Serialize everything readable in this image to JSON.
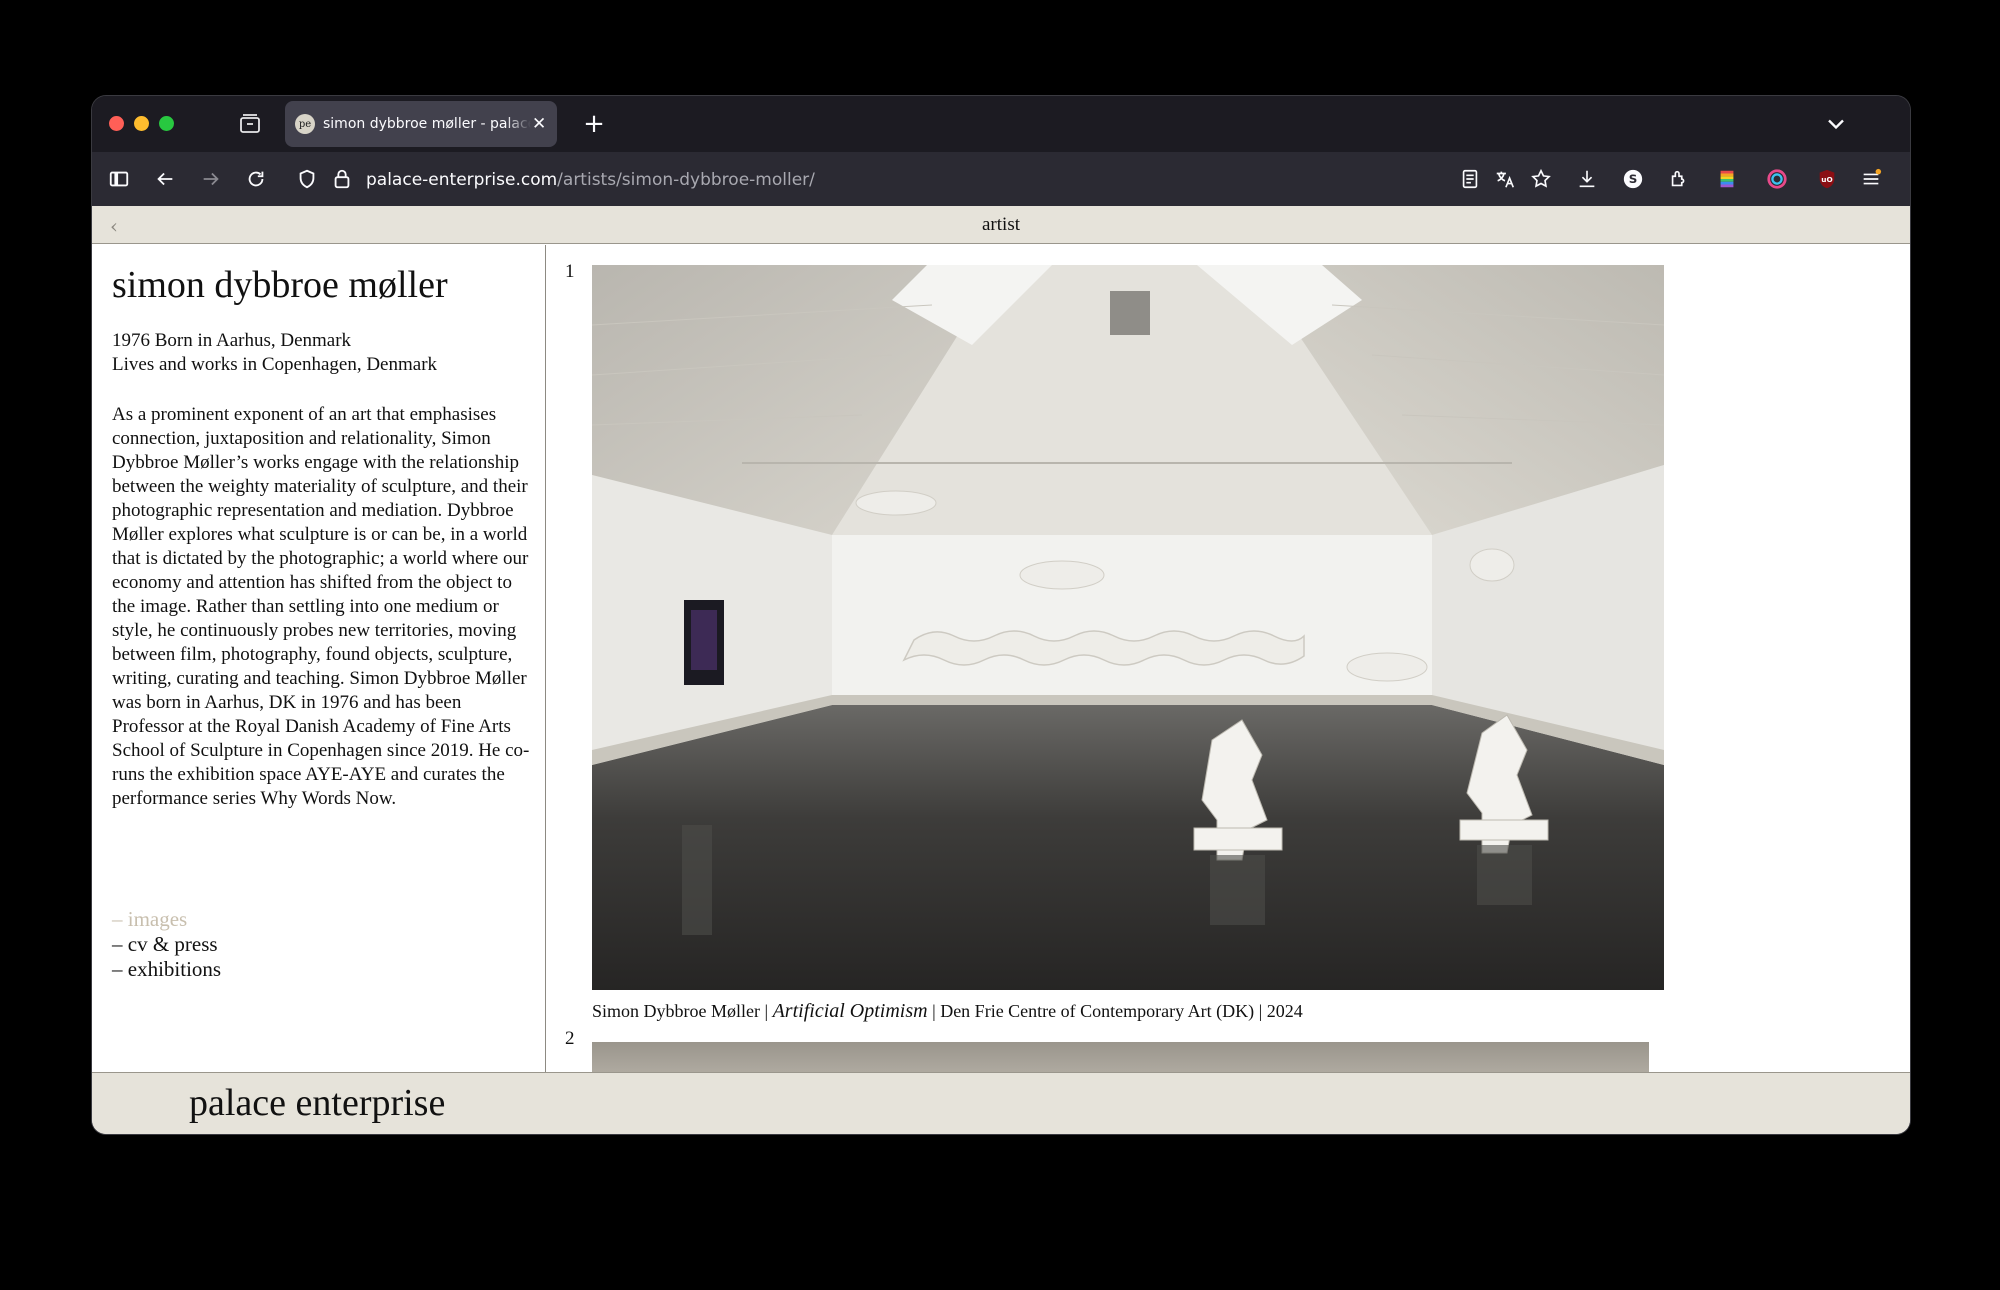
{
  "browser": {
    "tab_title": "simon dybbroe møller - palace enterprise",
    "favicon_text": "pe",
    "url_host": "palace-enterprise.com",
    "url_path": "/artists/simon-dybbroe-moller/"
  },
  "page": {
    "topbar_title": "artist",
    "artist_name": "simon dybbroe møller",
    "born": "1976 Born in Aarhus, Denmark",
    "lives": "Lives and works in Copenhagen, Denmark",
    "bio": "As a prominent exponent of an art that emphasises connection, juxtaposition and relationality, Simon Dybbroe Møller’s works engage with the relationship between the weighty materiality of sculpture, and their photographic representation and mediation. Dybbroe Møller explores what sculpture is or can be, in a world that is dictated by the photographic; a world where our economy and attention has shifted from the object to the image. Rather than settling into one medium or style, he continuously probes new territories, moving between film, photography, found objects, sculpture, writing, curating and teaching. Simon Dybbroe Møller was born in Aarhus, DK in 1976 and has been Professor at the Royal Danish Academy of Fine Arts School of Sculpture in Copenhagen since 2019. He co-runs the exhibition space AYE-AYE and curates the performance series Why Words Now.",
    "links": [
      {
        "label": "– images",
        "active": true
      },
      {
        "label": "– cv & press",
        "active": false
      },
      {
        "label": "– exhibitions",
        "active": false
      }
    ],
    "images": [
      {
        "number": "1",
        "caption_prefix": "Simon Dybbroe Møller | ",
        "caption_title": "Artificial Optimism",
        "caption_suffix": " | Den Frie Centre of Contemporary Art (DK) | 2024"
      },
      {
        "number": "2"
      }
    ],
    "footer_logo": "palace enterprise"
  }
}
